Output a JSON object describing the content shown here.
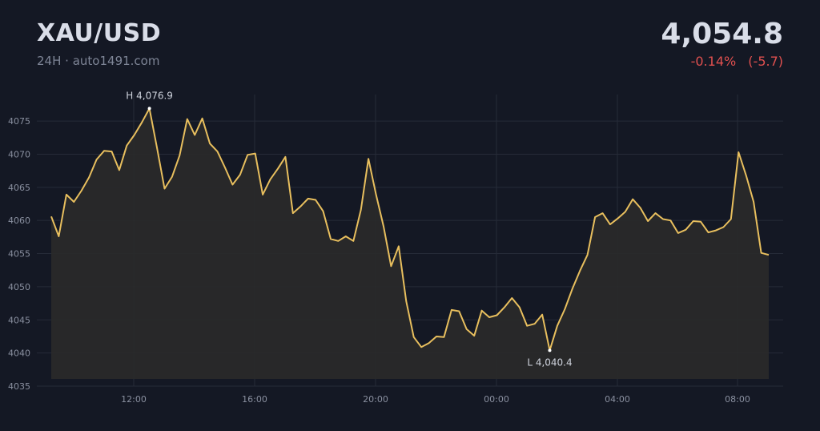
{
  "header": {
    "symbol": "XAU/USD",
    "period": "24H",
    "separator": "·",
    "source": "auto1491.com",
    "price": "4,054.8",
    "change_pct": "-0.14%",
    "change_abs": "(-5.7)"
  },
  "colors": {
    "background": "#141824",
    "line": "#e8bf5e",
    "area": "#2a2a2a",
    "grid": "#262b38",
    "negative": "#e0504f"
  },
  "chart_data": {
    "type": "area",
    "x_start": "09:15",
    "x_step_minutes": 15,
    "x_tick_labels": [
      "12:00",
      "16:00",
      "20:00",
      "00:00",
      "04:00",
      "08:00"
    ],
    "y_tick_labels": [
      "4035",
      "4040",
      "4045",
      "4050",
      "4055",
      "4060",
      "4065",
      "4070",
      "4075"
    ],
    "ylim": [
      4035,
      4079
    ],
    "grid": true,
    "series": [
      {
        "values": [
          4060.6,
          4057.6,
          4063.9,
          4062.8,
          4064.5,
          4066.5,
          4069.2,
          4070.5,
          4070.4,
          4067.6,
          4071.3,
          4072.9,
          4074.8,
          4076.9,
          4071.0,
          4064.8,
          4066.6,
          4069.8,
          4075.3,
          4072.9,
          4075.4,
          4071.6,
          4070.4,
          4068.0,
          4065.4,
          4066.9,
          4069.9,
          4070.1,
          4063.9,
          4066.2,
          4067.8,
          4069.6,
          4061.1,
          4062.1,
          4063.3,
          4063.1,
          4061.4,
          4057.2,
          4056.9,
          4057.6,
          4056.9,
          4061.6,
          4069.3,
          4063.9,
          4059.1,
          4053.1,
          4056.1,
          4047.8,
          4042.4,
          4040.9,
          4041.5,
          4042.5,
          4042.4,
          4046.5,
          4046.3,
          4043.6,
          4042.6,
          4046.4,
          4045.4,
          4045.7,
          4046.9,
          4048.3,
          4046.9,
          4044.1,
          4044.4,
          4045.8,
          4040.4,
          4044.1,
          4046.6,
          4049.7,
          4052.4,
          4054.8,
          4060.5,
          4061.1,
          4059.4,
          4060.3,
          4061.3,
          4063.2,
          4061.9,
          4059.9,
          4061.1,
          4060.2,
          4060.0,
          4058.1,
          4058.6,
          4059.9,
          4059.8,
          4058.2,
          4058.5,
          4059.0,
          4060.2,
          4070.3,
          4066.8,
          4062.8,
          4055.1,
          4054.8
        ]
      }
    ],
    "high_label": "H 4,076.9",
    "low_label": "L 4,040.4"
  }
}
